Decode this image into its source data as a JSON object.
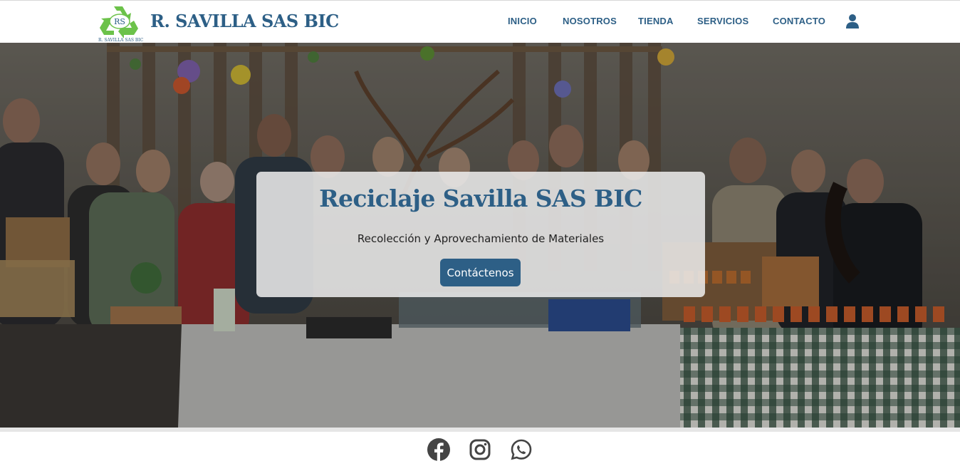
{
  "header": {
    "logo_letters": "RS",
    "logo_caption": "R. SAVILLA SAS BIC",
    "brand": "R. SAVILLA SAS BIC",
    "nav": [
      {
        "label": "INICIO"
      },
      {
        "label": "NOSOTROS"
      },
      {
        "label": "TIENDA"
      },
      {
        "label": "SERVICIOS"
      },
      {
        "label": "CONTACTO"
      }
    ],
    "user_icon": "user-icon"
  },
  "hero": {
    "title": "Reciclaje Savilla SAS BIC",
    "subtitle": "Recolección y Aprovechamiento de Materiales",
    "cta_label": "Contáctenos"
  },
  "footer": {
    "social": [
      {
        "icon": "facebook-icon"
      },
      {
        "icon": "instagram-icon"
      },
      {
        "icon": "whatsapp-icon"
      }
    ]
  },
  "colors": {
    "brand_blue": "#2d5f86",
    "logo_green": "#6cc24a",
    "card_bg": "#eeeeee",
    "icon_gray": "#444444"
  }
}
